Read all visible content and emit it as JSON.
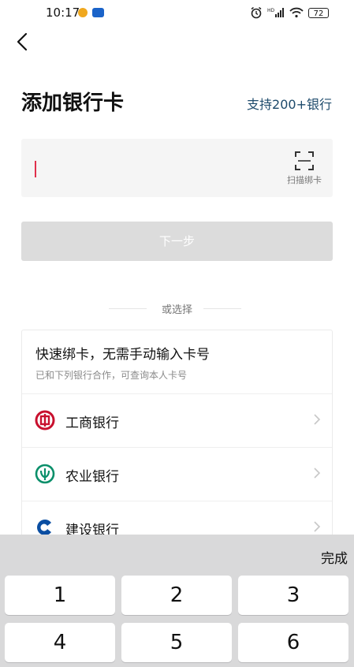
{
  "status_bar": {
    "time": "10:17",
    "battery": "72"
  },
  "header": {
    "title": "添加银行卡",
    "support_link": "支持200+银行"
  },
  "card_input": {
    "value": "",
    "scan_label": "扫描绑卡"
  },
  "next_button": {
    "label": "下一步"
  },
  "divider": {
    "label": "或选择"
  },
  "quick_bind": {
    "title": "快速绑卡，无需手动输入卡号",
    "subtitle": "已和下列银行合作，可查询本人卡号",
    "banks": [
      {
        "name": "工商银行",
        "color": "#c8102e",
        "icon": "icbc-logo-icon"
      },
      {
        "name": "农业银行",
        "color": "#0a8f6a",
        "icon": "abc-logo-icon"
      },
      {
        "name": "建设银行",
        "color": "#0a4ea2",
        "icon": "ccb-logo-icon"
      }
    ]
  },
  "keyboard": {
    "done_label": "完成",
    "keys": [
      "1",
      "2",
      "3",
      "4",
      "5",
      "6"
    ]
  }
}
